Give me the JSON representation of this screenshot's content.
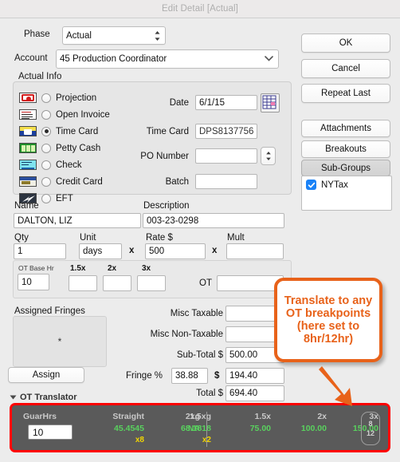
{
  "window": {
    "title": "Edit Detail [Actual]"
  },
  "form": {
    "phase": {
      "label": "Phase",
      "value": "Actual",
      "icon": "stepper-updown-icon"
    },
    "account": {
      "label": "Account",
      "value": "45 Production Coordinator",
      "icon": "chevron-down-icon"
    },
    "group_title": "Actual Info",
    "payment_types": [
      {
        "label": "Projection",
        "selected": false,
        "icon": "projection-icon"
      },
      {
        "label": "Open Invoice",
        "selected": false,
        "icon": "invoice-icon"
      },
      {
        "label": "Time Card",
        "selected": true,
        "icon": "timecard-icon"
      },
      {
        "label": "Petty Cash",
        "selected": false,
        "icon": "cash-icon"
      },
      {
        "label": "Check",
        "selected": false,
        "icon": "check-icon"
      },
      {
        "label": "Credit Card",
        "selected": false,
        "icon": "creditcard-icon"
      },
      {
        "label": "EFT",
        "selected": false,
        "icon": "eft-icon"
      }
    ],
    "date": {
      "label": "Date",
      "value": "6/1/15",
      "picker_icon": "calendar-icon"
    },
    "time_card": {
      "label": "Time Card",
      "value": "DPS8137756"
    },
    "po_number": {
      "label": "PO Number",
      "value": "",
      "icon": "stepper-updown-icon"
    },
    "batch": {
      "label": "Batch",
      "value": ""
    },
    "name": {
      "label": "Name",
      "value": "DALTON, LIZ"
    },
    "description": {
      "label": "Description",
      "value": "003-23-0298"
    },
    "qty": {
      "label": "Qty",
      "value": "1"
    },
    "unit": {
      "label": "Unit",
      "value": "days"
    },
    "rate": {
      "label": "Rate $",
      "value": "500"
    },
    "mult": {
      "label": "Mult",
      "value": ""
    },
    "times_1": "x",
    "times_2": "x",
    "ot_base_hr": {
      "label": "OT Base Hr",
      "value": "10"
    },
    "ot_15x": {
      "label": "1.5x",
      "value": ""
    },
    "ot_2x": {
      "label": "2x",
      "value": ""
    },
    "ot_3x": {
      "label": "3x",
      "value": ""
    },
    "ot": {
      "label": "OT",
      "value": ""
    },
    "assigned_fringes": {
      "label": "Assigned Fringes",
      "value": "*"
    },
    "assign_button": "Assign",
    "misc_taxable": {
      "label": "Misc Taxable",
      "value": ""
    },
    "misc_non_taxable": {
      "label": "Misc Non-Taxable",
      "value": ""
    },
    "sub_total": {
      "label": "Sub-Total $",
      "value": "500.00"
    },
    "fringe_pct": {
      "label": "Fringe %",
      "value": "38.88"
    },
    "fringe_amt": {
      "label": "$",
      "value": "194.40"
    },
    "total": {
      "label": "Total $",
      "value": "694.40"
    }
  },
  "buttons": {
    "ok": "OK",
    "cancel": "Cancel",
    "repeat_last": "Repeat Last",
    "attachments": "Attachments",
    "breakouts": "Breakouts",
    "sub_groups": "Sub-Groups"
  },
  "subgroup_list": {
    "items": [
      {
        "label": "NYTax",
        "checked": true
      }
    ]
  },
  "ot_translator": {
    "disclosure_label": "OT Translator",
    "columns": [
      {
        "header": "GuarHrs",
        "value": "10",
        "mult": ""
      },
      {
        "header": "Straight",
        "value": "45.4545",
        "mult": "x8"
      },
      {
        "header": "1.5xg",
        "value": "68.1818",
        "mult": "x2"
      },
      {
        "header": "2xg",
        "value": "NA",
        "mult": ""
      },
      {
        "header": "1.5x",
        "value": "75.00",
        "mult": ""
      },
      {
        "header": "2x",
        "value": "100.00",
        "mult": ""
      },
      {
        "header": "3x",
        "value": "150.00",
        "mult": ""
      }
    ],
    "breakpoint_badge": {
      "top": "8",
      "bottom": "12"
    }
  },
  "annotation": {
    "text": "Translate to any OT breakpoints (here set to 8hr/12hr)",
    "color": "#e8621a",
    "highlight_color": "#ff0000"
  }
}
